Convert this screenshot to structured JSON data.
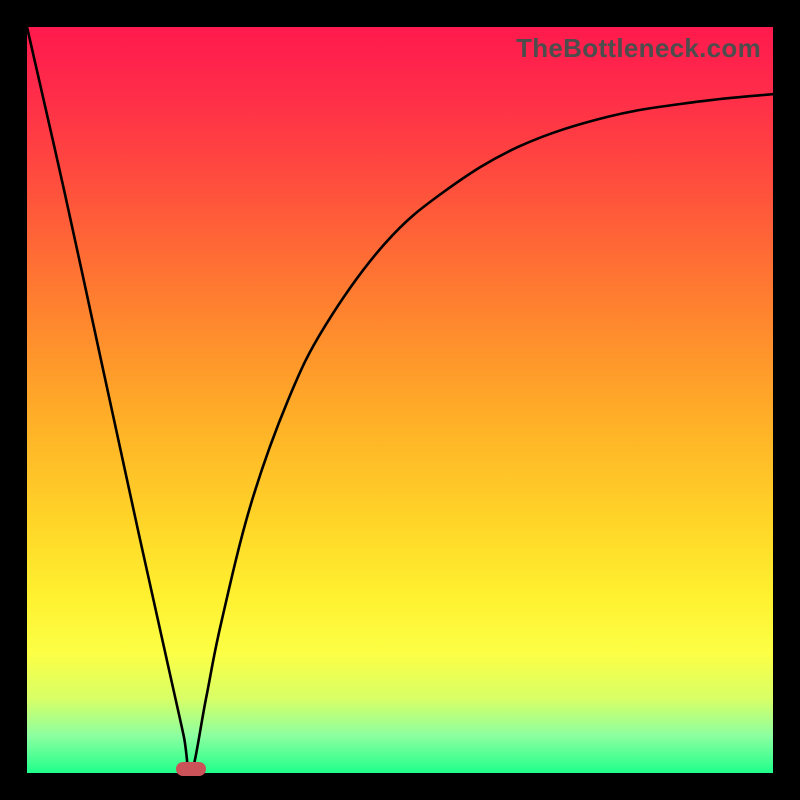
{
  "watermark": "TheBottleneck.com",
  "colors": {
    "frame": "#000000",
    "gradient_top": "#ff1a4d",
    "gradient_bottom": "#1fff8a",
    "curve": "#000000",
    "marker": "#cc525a"
  },
  "chart_data": {
    "type": "line",
    "title": "",
    "xlabel": "",
    "ylabel": "",
    "xlim": [
      0,
      100
    ],
    "ylim": [
      0,
      100
    ],
    "grid": false,
    "series": [
      {
        "name": "left-segment",
        "x": [
          0,
          5,
          10,
          15,
          19,
          21,
          22
        ],
        "y": [
          100,
          78,
          55,
          32,
          14,
          5,
          0
        ]
      },
      {
        "name": "right-segment",
        "x": [
          22,
          24,
          26,
          30,
          35,
          40,
          48,
          56,
          66,
          78,
          90,
          100
        ],
        "y": [
          0,
          10,
          20,
          36,
          50,
          60,
          71,
          78,
          84,
          88,
          90,
          91
        ]
      }
    ],
    "annotations": [
      {
        "name": "valley-marker",
        "x": 22,
        "y": 0
      }
    ]
  }
}
